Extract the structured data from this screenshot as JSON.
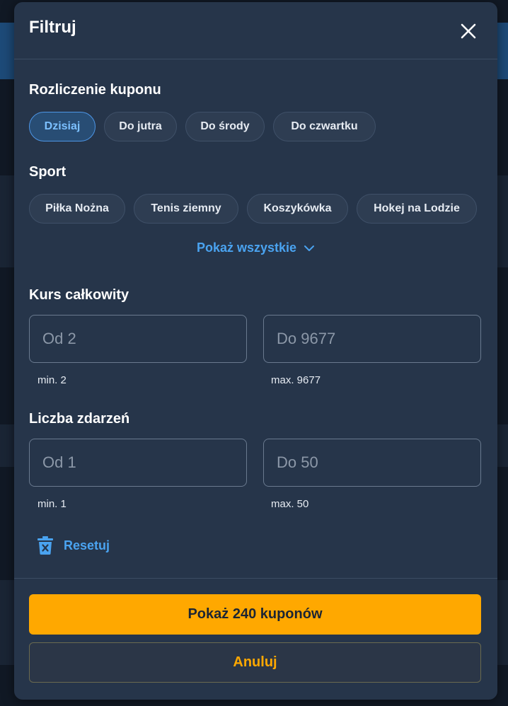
{
  "modal": {
    "title": "Filtruj"
  },
  "settlement": {
    "title": "Rozliczenie kuponu",
    "chips": [
      "Dzisiaj",
      "Do jutra",
      "Do środy",
      "Do czwartku"
    ]
  },
  "sport": {
    "title": "Sport",
    "chips": [
      "Piłka Nożna",
      "Tenis ziemny",
      "Koszykówka",
      "Hokej na Lodzie"
    ],
    "show_all": "Pokaż wszystkie"
  },
  "odds": {
    "title": "Kurs całkowity",
    "from_placeholder": "Od 2",
    "to_placeholder": "Do 9677",
    "min_hint": "min. 2",
    "max_hint": "max. 9677"
  },
  "events": {
    "title": "Liczba zdarzeń",
    "from_placeholder": "Od 1",
    "to_placeholder": "Do 50",
    "min_hint": "min. 1",
    "max_hint": "max. 50"
  },
  "reset_label": "Resetuj",
  "footer": {
    "primary_label": "Pokaż 240 kuponów",
    "secondary_label": "Anuluj"
  },
  "colors": {
    "accent_blue": "#4aa3f0",
    "accent_orange": "#ffa800",
    "modal_bg": "#26354a"
  }
}
